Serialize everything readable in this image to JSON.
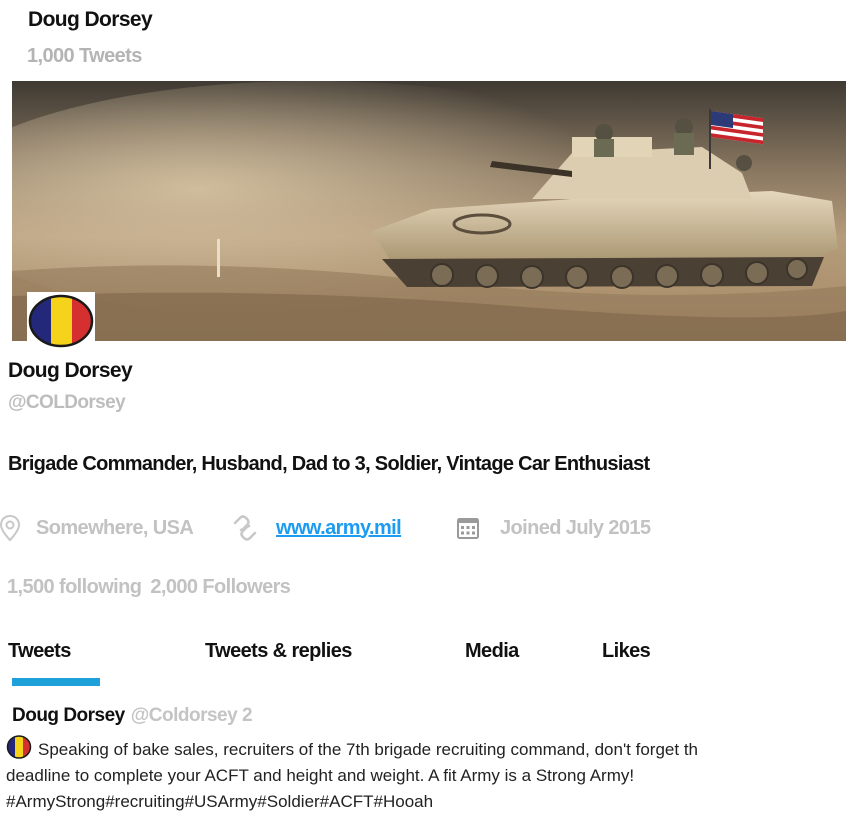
{
  "header": {
    "name": "Doug Dorsey",
    "tweet_count": "1,000 Tweets"
  },
  "profile": {
    "name": "Doug Dorsey",
    "handle": "@COLDorsey",
    "bio": "Brigade Commander, Husband, Dad to 3, Soldier, Vintage Car Enthusiast",
    "location": "Somewhere, USA",
    "website": "www.army.mil",
    "joined": "Joined July 2015",
    "following": "1,500 following",
    "followers": "2,000 Followers",
    "icons": {
      "location": "map-pin-icon",
      "link": "link-icon",
      "calendar": "calendar-icon"
    }
  },
  "tabs": [
    {
      "label": "Tweets",
      "active": true
    },
    {
      "label": "Tweets & replies",
      "active": false
    },
    {
      "label": "Media",
      "active": false
    },
    {
      "label": "Likes",
      "active": false
    }
  ],
  "tweet": {
    "name": "Doug Dorsey",
    "handle_and_time": "@Coldorsey 2",
    "line1": "Speaking of bake sales, recruiters of the 7th brigade recruiting command, don't forget th",
    "line2": "deadline to complete your ACFT and height and weight.  A fit Army is a Strong Army!",
    "line3": "#ArmyStrong#recruiting#USArmy#Soldier#ACFT#Hooah"
  },
  "colors": {
    "accent": "#1da1d8",
    "link": "#1d9bf0",
    "muted": "#c2c2c2",
    "avatar_blue": "#24287a",
    "avatar_yellow": "#f6d31b",
    "avatar_red": "#d52f2f"
  }
}
